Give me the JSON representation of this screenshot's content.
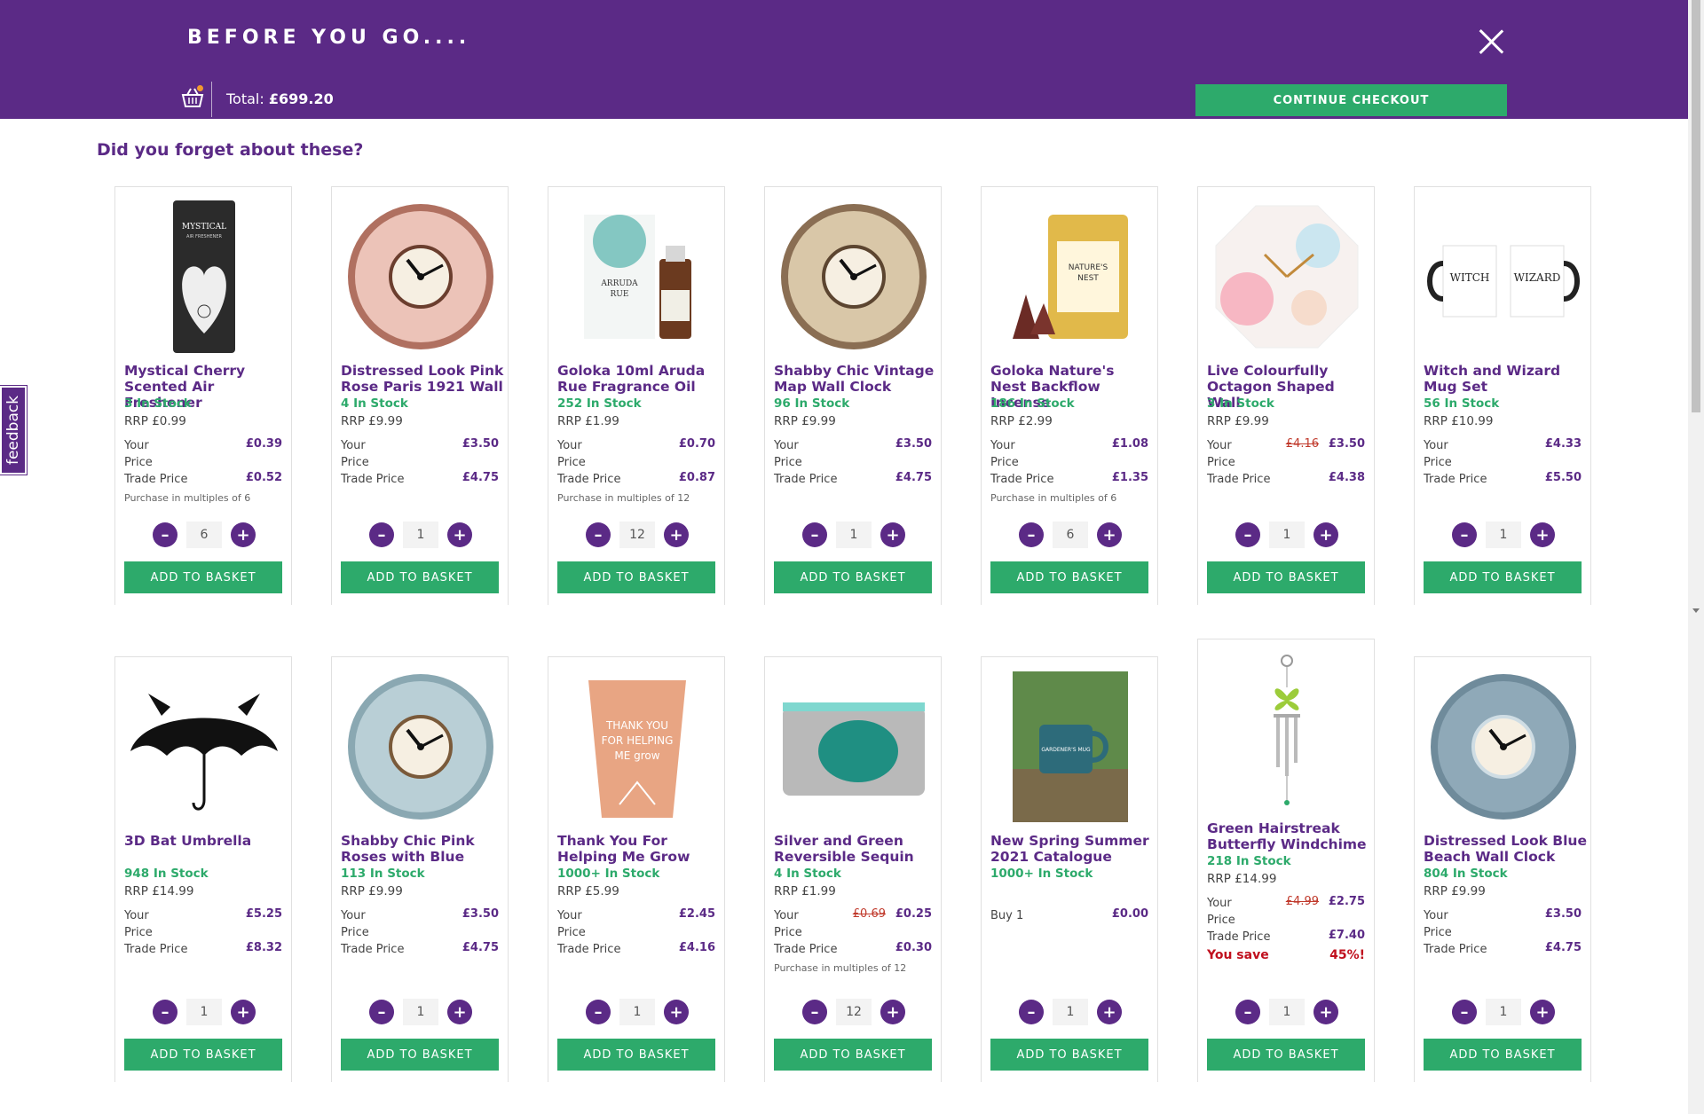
{
  "header": {
    "title": "BEFORE YOU GO....",
    "total_label": "Total:",
    "total_value": "£699.20",
    "checkout_label": "CONTINUE CHECKOUT"
  },
  "feedback_label": "feedback",
  "heading": "Did you forget about these?",
  "add_label": "ADD TO BASKET",
  "products": [
    {
      "name": "Mystical Cherry Scented Air Freshener",
      "stock": "3 In Stock",
      "rrp": "RRP £0.99",
      "your_label": "Your",
      "price_label": "Price",
      "your_price": "£0.39",
      "trade_label": "Trade Price",
      "trade_price": "£0.52",
      "multiple": "Purchase in multiples of 6",
      "qty": "6",
      "icon": "air-freshener-image"
    },
    {
      "name": "Distressed Look Pink Rose Paris 1921 Wall",
      "stock": "4 In Stock",
      "rrp": "RRP £9.99",
      "your_label": "Your",
      "price_label": "Price",
      "your_price": "£3.50",
      "trade_label": "Trade Price",
      "trade_price": "£4.75",
      "qty": "1",
      "icon": "pink-clock-image"
    },
    {
      "name": "Goloka 10ml Aruda Rue Fragrance Oil",
      "stock": "252 In Stock",
      "rrp": "RRP £1.99",
      "your_label": "Your",
      "price_label": "Price",
      "your_price": "£0.70",
      "trade_label": "Trade Price",
      "trade_price": "£0.87",
      "multiple": "Purchase in multiples of 12",
      "qty": "12",
      "icon": "fragrance-oil-image"
    },
    {
      "name": "Shabby Chic Vintage Map Wall Clock",
      "stock": "96 In Stock",
      "rrp": "RRP £9.99",
      "your_label": "Your",
      "price_label": "Price",
      "your_price": "£3.50",
      "trade_label": "Trade Price",
      "trade_price": "£4.75",
      "qty": "1",
      "icon": "map-clock-image"
    },
    {
      "name": "Goloka Nature's Nest Backflow Incense",
      "stock": "186 In Stock",
      "rrp": "RRP £2.99",
      "your_label": "Your",
      "price_label": "Price",
      "your_price": "£1.08",
      "trade_label": "Trade Price",
      "trade_price": "£1.35",
      "multiple": "Purchase in multiples of 6",
      "qty": "6",
      "icon": "incense-tin-image"
    },
    {
      "name": "Live Colourfully Octagon Shaped Wall",
      "stock": "3 In Stock",
      "rrp": "RRP £9.99",
      "your_label": "Your",
      "price_label": "Price",
      "old_price": "£4.16",
      "your_price": "£3.50",
      "trade_label": "Trade Price",
      "trade_price": "£4.38",
      "qty": "1",
      "icon": "octagon-clock-image"
    },
    {
      "name": "Witch and Wizard Mug Set",
      "stock": "56 In Stock",
      "rrp": "RRP £10.99",
      "your_label": "Your",
      "price_label": "Price",
      "your_price": "£4.33",
      "trade_label": "Trade Price",
      "trade_price": "£5.50",
      "qty": "1",
      "icon": "mug-set-image"
    },
    {
      "name": "3D Bat Umbrella",
      "stock": "948 In Stock",
      "rrp": "RRP £14.99",
      "your_label": "Your",
      "price_label": "Price",
      "your_price": "£5.25",
      "trade_label": "Trade Price",
      "trade_price": "£8.32",
      "qty": "1",
      "icon": "bat-umbrella-image"
    },
    {
      "name": "Shabby Chic Pink Roses with Blue",
      "stock": "113 In Stock",
      "rrp": "RRP £9.99",
      "your_label": "Your",
      "price_label": "Price",
      "your_price": "£3.50",
      "trade_label": "Trade Price",
      "trade_price": "£4.75",
      "qty": "1",
      "icon": "blue-rose-clock-image"
    },
    {
      "name": "Thank You For Helping Me Grow",
      "stock": "1000+ In Stock",
      "rrp": "RRP £5.99",
      "your_label": "Your",
      "price_label": "Price",
      "your_price": "£2.45",
      "trade_label": "Trade Price",
      "trade_price": "£4.16",
      "qty": "1",
      "icon": "plant-pot-image"
    },
    {
      "name": "Silver and Green Reversible Sequin",
      "stock": "4 In Stock",
      "rrp": "RRP £1.99",
      "your_label": "Your",
      "price_label": "Price",
      "old_price": "£0.69",
      "your_price": "£0.25",
      "trade_label": "Trade Price",
      "trade_price": "£0.30",
      "multiple": "Purchase in multiples of 12",
      "qty": "12",
      "icon": "sequin-pouch-image"
    },
    {
      "name": "New Spring Summer 2021 Catalogue",
      "stock": "1000+ In Stock",
      "buy_label": "Buy 1",
      "buy_price": "£0.00",
      "qty": "1",
      "icon": "catalogue-image"
    },
    {
      "name": "Green Hairstreak Butterfly Windchime",
      "stock": "218 In Stock",
      "rrp": "RRP £14.99",
      "your_label": "Your",
      "price_label": "Price",
      "old_price": "£4.99",
      "your_price": "£2.75",
      "trade_label": "Trade Price",
      "trade_price": "£7.40",
      "save_label": "You save",
      "save_pct": "45%!",
      "qty": "1",
      "icon": "windchime-image"
    },
    {
      "name": "Distressed Look Blue Beach Wall Clock",
      "stock": "804 In Stock",
      "rrp": "RRP £9.99",
      "your_label": "Your",
      "price_label": "Price",
      "your_price": "£3.50",
      "trade_label": "Trade Price",
      "trade_price": "£4.75",
      "qty": "1",
      "icon": "beach-clock-image"
    }
  ]
}
